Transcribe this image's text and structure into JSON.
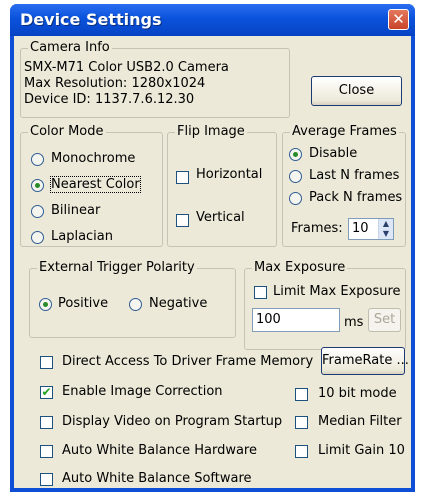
{
  "window": {
    "title": "Device Settings",
    "close_glyph": "✕"
  },
  "camera_info": {
    "label": "Camera Info",
    "lines": [
      "SMX-M71 Color USB2.0 Camera",
      "Max Resolution: 1280x1024",
      "Device ID: 1137.7.6.12.30"
    ]
  },
  "close_button": "Close",
  "color_mode": {
    "label": "Color Mode",
    "options": [
      "Monochrome",
      "Nearest Color",
      "Bilinear",
      "Laplacian"
    ],
    "selected": "Nearest Color"
  },
  "flip_image": {
    "label": "Flip Image",
    "horizontal": "Horizontal",
    "vertical": "Vertical"
  },
  "average_frames": {
    "label": "Average Frames",
    "options": [
      "Disable",
      "Last N frames",
      "Pack N frames"
    ],
    "selected": "Disable",
    "frames_label": "Frames:",
    "frames_value": "10"
  },
  "trigger": {
    "label": "External Trigger Polarity",
    "positive": "Positive",
    "negative": "Negative",
    "selected": "Positive"
  },
  "max_exposure": {
    "label": "Max Exposure",
    "limit_label": "Limit Max Exposure",
    "value": "100",
    "unit": "ms",
    "set_button": "Set"
  },
  "options": {
    "direct_access": "Direct Access To Driver Frame Memory",
    "framerate_button": "FrameRate ...",
    "enable_correction": "Enable Image Correction",
    "ten_bit": "10 bit mode",
    "display_on_startup": "Display Video on Program Startup",
    "median_filter": "Median Filter",
    "awb_hardware": "Auto White Balance Hardware",
    "limit_gain": "Limit Gain 10",
    "awb_software": "Auto White Balance Software"
  },
  "checked_glyph": "✔"
}
